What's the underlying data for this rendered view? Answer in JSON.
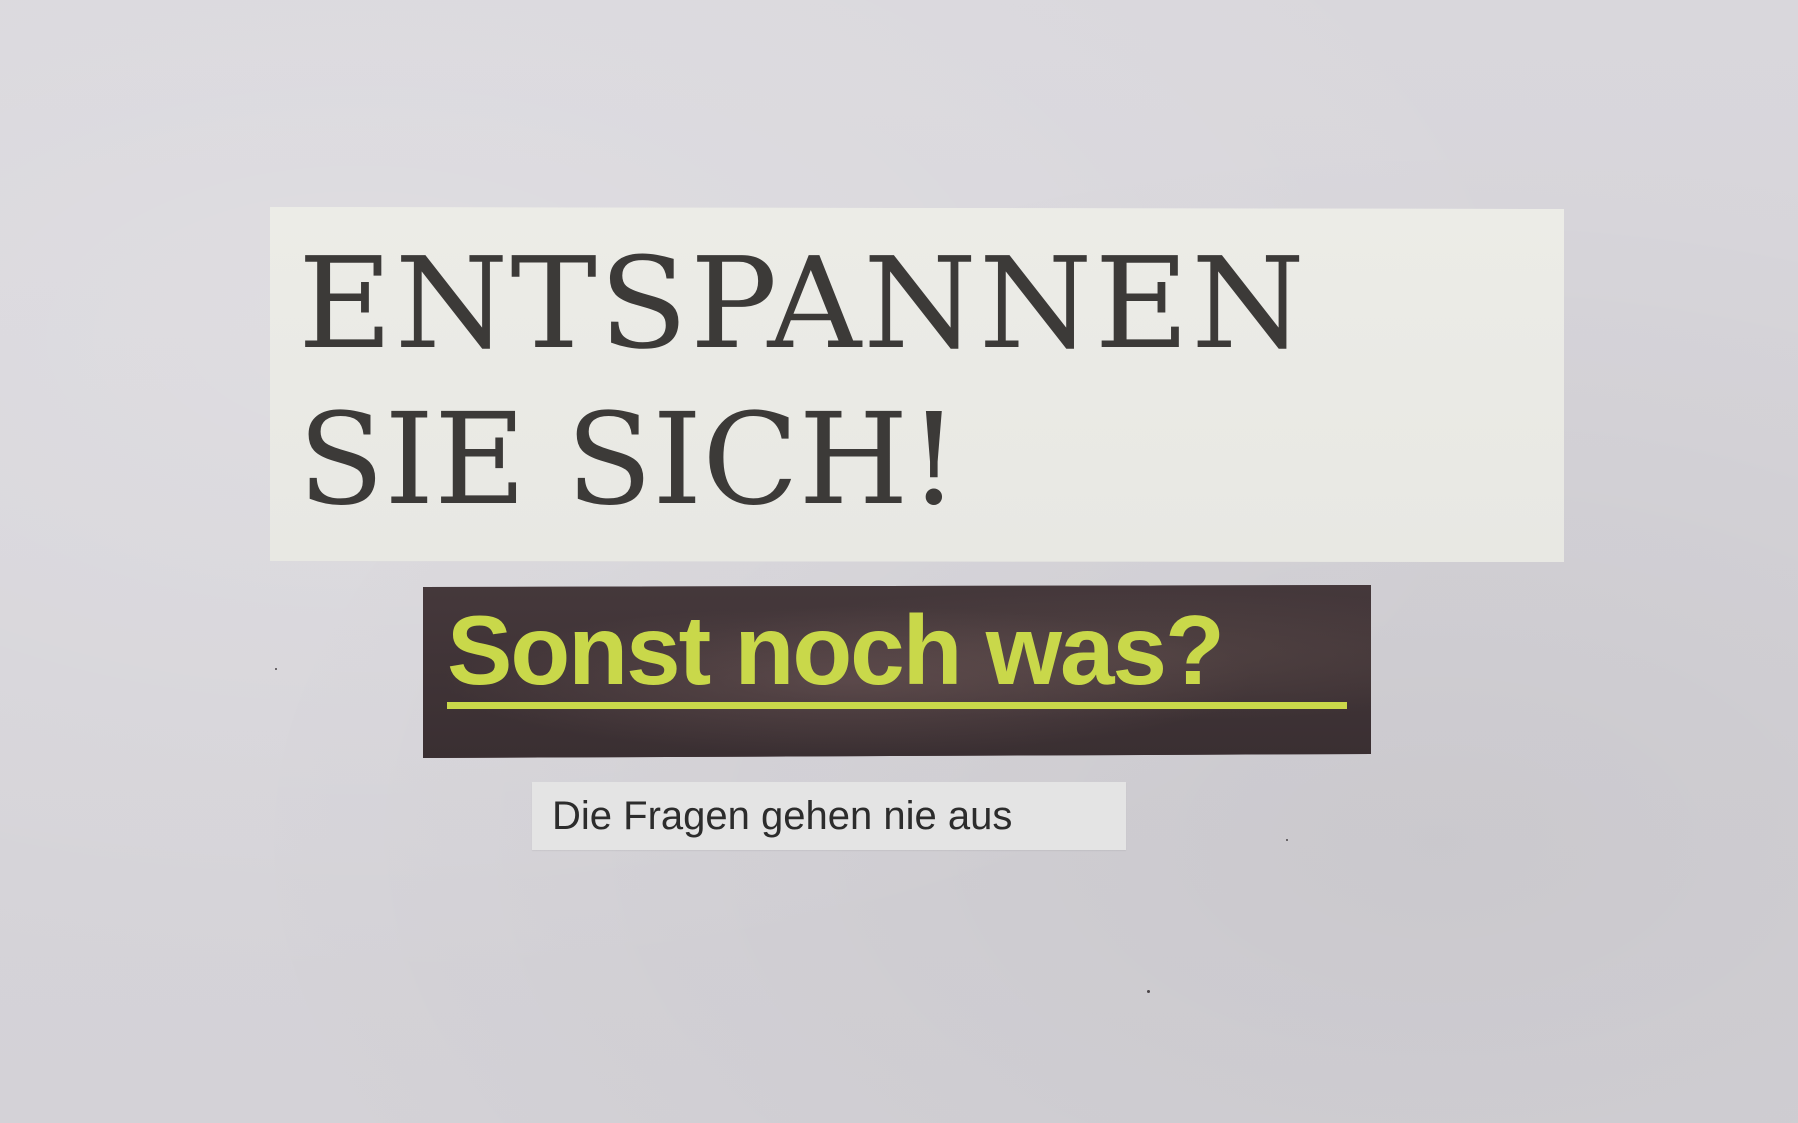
{
  "clippings": {
    "headline": {
      "line1": "ENTSPANNEN",
      "line2": "SIE SICH!"
    },
    "question": {
      "text": "Sonst noch was?",
      "text_color": "#c9d84a",
      "background_color": "#3f3336"
    },
    "subtitle": {
      "text": "Die Fragen gehen nie aus"
    }
  },
  "background_color": "#d6d4d9"
}
